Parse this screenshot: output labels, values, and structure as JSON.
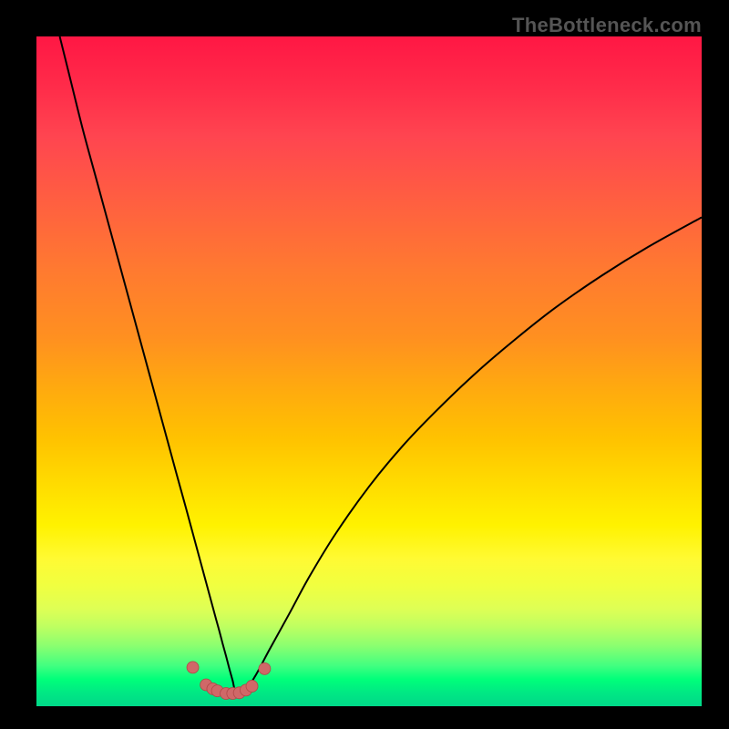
{
  "watermark": "TheBottleneck.com",
  "colors": {
    "frame": "#000000",
    "curve": "#000000",
    "dot_fill": "#d06868",
    "dot_stroke": "#b04848"
  },
  "chart_data": {
    "type": "line",
    "title": "",
    "xlabel": "",
    "ylabel": "",
    "xlim": [
      0,
      100
    ],
    "ylim": [
      0,
      100
    ],
    "legend": false,
    "annotations": [],
    "series": [
      {
        "name": "bottleneck-curve",
        "x": [
          3.5,
          5,
          7,
          9,
          11,
          13,
          15,
          17,
          19,
          21,
          22.5,
          24,
          25.5,
          27,
          27.5,
          28,
          28.5,
          29,
          29.5,
          30,
          31.2,
          33,
          35,
          38,
          41,
          45,
          50,
          55,
          60,
          66,
          72,
          78,
          85,
          92,
          100
        ],
        "y": [
          100,
          94,
          86,
          78.7,
          71.4,
          64.1,
          56.8,
          49.5,
          42.2,
          34.9,
          29.5,
          24,
          18.5,
          13,
          11.2,
          9.3,
          7.5,
          5.6,
          3.8,
          2,
          2,
          4.7,
          8.4,
          13.8,
          19.3,
          25.8,
          32.8,
          38.8,
          44,
          49.7,
          54.8,
          59.5,
          64.3,
          68.6,
          73
        ]
      },
      {
        "name": "fit-region-dots",
        "x": [
          23.5,
          25.5,
          26.5,
          27.2,
          28.5,
          29.5,
          30.5,
          31.5,
          32.4,
          34.3
        ],
        "y": [
          5.8,
          3.2,
          2.6,
          2.3,
          1.9,
          1.9,
          2.0,
          2.4,
          3.0,
          5.6
        ]
      }
    ]
  }
}
